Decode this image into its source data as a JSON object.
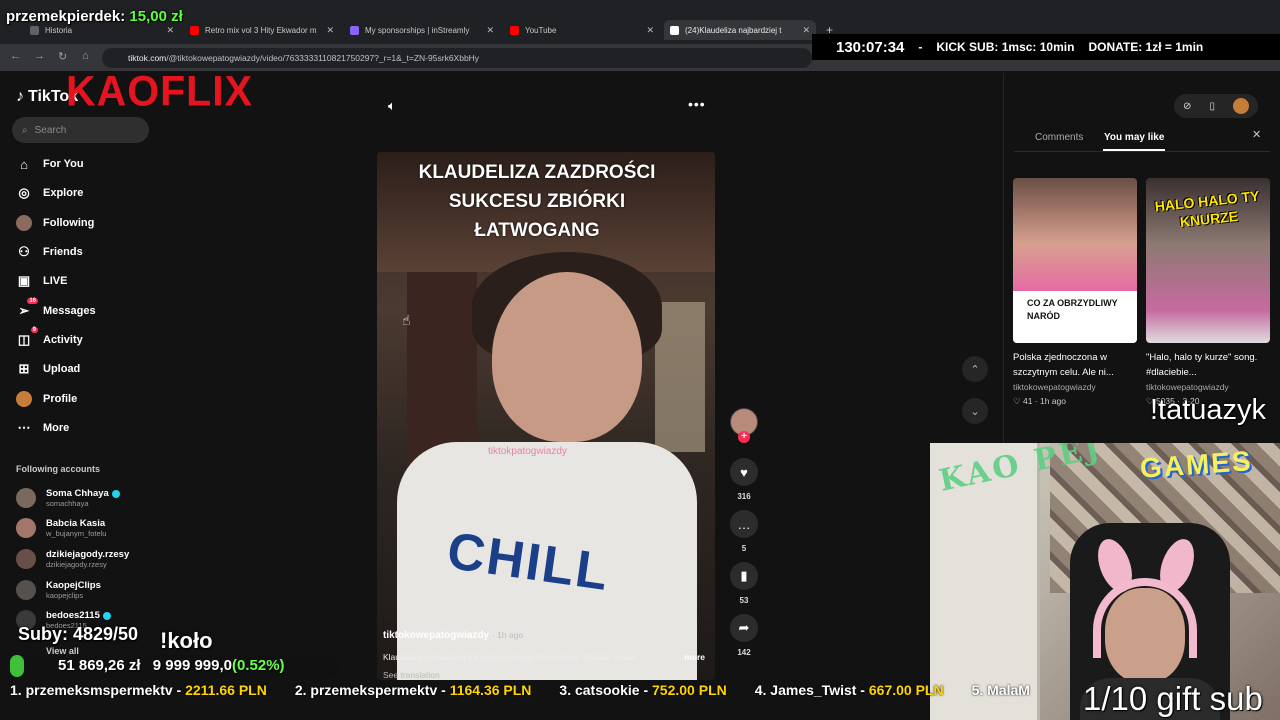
{
  "browser": {
    "tabs": [
      {
        "label": "Historia",
        "active": false
      },
      {
        "label": "Retro mix vol 3 Hity Ekwador m",
        "active": false
      },
      {
        "label": "My sponsorships | inStreamly",
        "active": false
      },
      {
        "label": "YouTube",
        "active": false
      },
      {
        "label": "(24)Klaudeliza najbardziej t",
        "active": true
      }
    ],
    "url_domain": "tiktok.com",
    "url_rest": "/@tiktokowepatogwiazdy/video/7633333110821750297?_r=1&_t=ZN-95srk6XbbHy"
  },
  "overlay": {
    "donor_name": "przemekpierdek:",
    "donor_amount": "15,00 zł",
    "timer": "130:07:34",
    "kick_sub": "KICK SUB: 1msc: 10min",
    "donate": "DONATE: 1zł = 1min",
    "kaoflix": "KAOFLIX",
    "subs": "Suby: 4829/50",
    "kolo": "!koło",
    "goal_current": "51 869,26 zł",
    "goal_target": "9 999 999,0",
    "goal_percent_text": "(0.52%)",
    "goal_percent": 0.52,
    "tatuazyk": "!tatuazyk",
    "gift_sub": "1/10 gift sub",
    "leaderboard": [
      {
        "rank": "1.",
        "name": "przemeksmspermektv",
        "amount": "2211.66 PLN"
      },
      {
        "rank": "2.",
        "name": "przemekspermektv",
        "amount": "1164.36 PLN"
      },
      {
        "rank": "3.",
        "name": "catsookie",
        "amount": "752.00 PLN"
      },
      {
        "rank": "4.",
        "name": "James_Twist",
        "amount": "667.00 PLN"
      },
      {
        "rank": "5.",
        "name": "MalaM",
        "amount": ""
      }
    ],
    "cam_graffiti": "KAO PEJ",
    "cam_games": "GAMES"
  },
  "sidebar": {
    "logo": "TikTok",
    "search_placeholder": "Search",
    "nav": [
      {
        "label": "For You",
        "icon": "home-icon"
      },
      {
        "label": "Explore",
        "icon": "compass-icon"
      },
      {
        "label": "Following",
        "icon": "following-avatar-icon"
      },
      {
        "label": "Friends",
        "icon": "friends-icon"
      },
      {
        "label": "LIVE",
        "icon": "live-icon"
      },
      {
        "label": "Messages",
        "icon": "messages-icon",
        "badge": "16"
      },
      {
        "label": "Activity",
        "icon": "activity-icon",
        "badge": "9"
      },
      {
        "label": "Upload",
        "icon": "upload-icon"
      },
      {
        "label": "Profile",
        "icon": "profile-avatar-icon"
      },
      {
        "label": "More",
        "icon": "more-icon"
      }
    ],
    "following_title": "Following accounts",
    "accounts": [
      {
        "name": "Soma Chhaya",
        "handle": "somachhaya",
        "verified": true
      },
      {
        "name": "Babcia Kasia",
        "handle": "w_bujanym_fotelu",
        "verified": false
      },
      {
        "name": "dzikiejagody.rzesy",
        "handle": "dzikiejagody.rzesy",
        "verified": false
      },
      {
        "name": "KaopejClips",
        "handle": "kaopejclips",
        "verified": false
      },
      {
        "name": "bedoes2115",
        "handle": "bedoes2115",
        "verified": true
      }
    ],
    "view_all": "View all"
  },
  "video": {
    "overlay_text_lines": [
      "KLAUDELIZA ZAZDROŚCI",
      "SUKCESU ZBIÓRKI",
      "ŁATWOGANG"
    ],
    "shirt_text": "CHILL",
    "watermark": "tiktokpatogwiazdy",
    "author": "tiktokowepatogwiazdy",
    "ago": "· 1h ago",
    "description": "Klaudeliza najbardziej toksyczny twórca internetowy.  Szkoda nawet",
    "more": "more",
    "see_translation": "See translation",
    "likes": "316",
    "comments": "5",
    "saves": "53",
    "shares": "142"
  },
  "right_panel": {
    "tabs": [
      "Comments",
      "You may like"
    ],
    "active_tab": "You may like",
    "items": [
      {
        "thumb_caption": "CO ZA OBRZYDLIWY NARÓD",
        "title": "Polska zjednoczona w szczytnym celu. Ale ni...",
        "user": "tiktokowepatogwiazdy",
        "meta": "♡ 41 · 1h ago"
      },
      {
        "thumb_caption": "HALO HALO TY KNURZE",
        "title": "\"Halo, halo ty kurze\" song. #dlaciebie...",
        "user": "tiktokowepatogwiazdy",
        "meta": "♡ 5035 · 3-20"
      }
    ]
  }
}
